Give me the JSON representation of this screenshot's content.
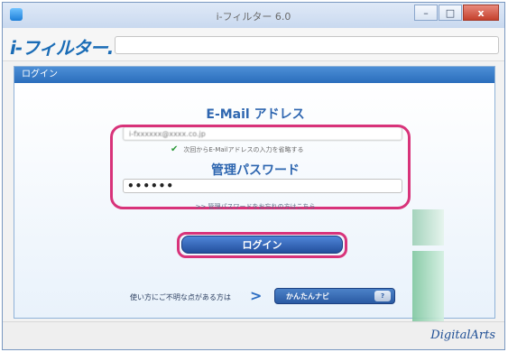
{
  "window": {
    "title": "i-フィルター 6.0",
    "controls": {
      "minimize": "–",
      "maximize": "□",
      "close": "x"
    }
  },
  "app": {
    "logo_text": "i-フィルター."
  },
  "login_panel": {
    "header": "ログイン",
    "email": {
      "label": "E-Mail アドレス",
      "value": "i-fxxxxxx@xxxx.co.jp"
    },
    "remember": {
      "checked": true,
      "text": "次回からE-Mailアドレスの入力を省略する"
    },
    "password": {
      "label": "管理パスワード",
      "masked_value": "••••••"
    },
    "forgot_link": ">> 管理パスワードをお忘れの方はこちら",
    "login_button": "ログイン"
  },
  "help": {
    "text": "使い方にご不明な点がある方は",
    "arrow": ">",
    "navi_button": "かんたんナビ",
    "navi_badge": "?"
  },
  "footer": {
    "brand": "DigitalArts"
  },
  "colors": {
    "highlight": "#d8337a",
    "accent": "#2e66b0",
    "panel_header": "#2a6dbc"
  }
}
